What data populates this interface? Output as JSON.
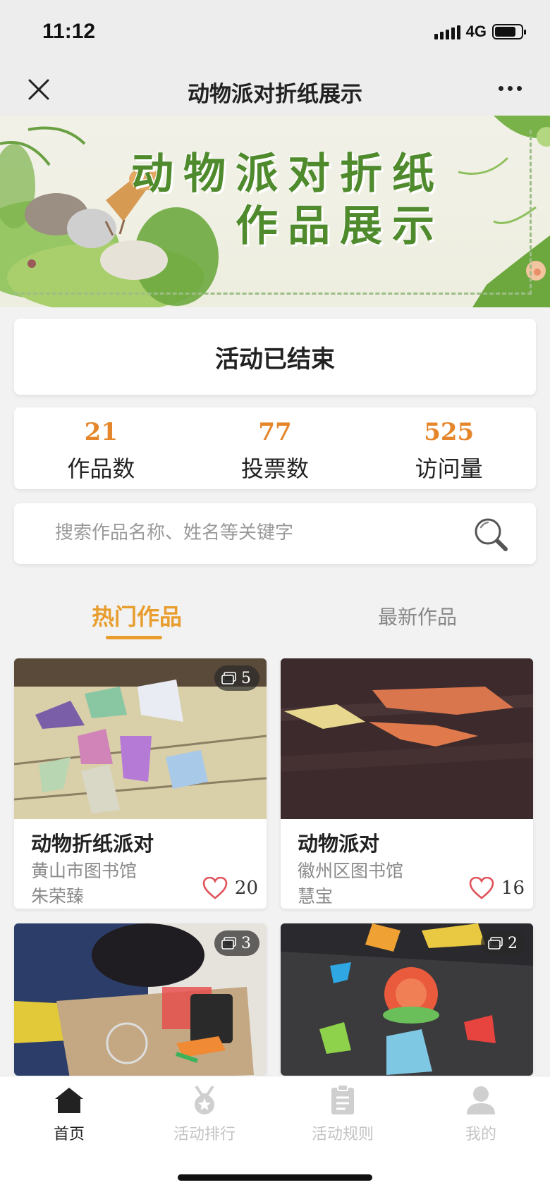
{
  "status_bar": {
    "time": "11:12",
    "network": "4G",
    "battery_level": 0.8
  },
  "nav": {
    "title": "动物派对折纸展示"
  },
  "banner": {
    "title_line1": "动物派对折纸",
    "title_line2": "作品展示"
  },
  "activity_status": "活动已结束",
  "stats": [
    {
      "value": "21",
      "label": "作品数"
    },
    {
      "value": "77",
      "label": "投票数"
    },
    {
      "value": "525",
      "label": "访问量"
    }
  ],
  "search": {
    "placeholder": "搜索作品名称、姓名等关键字"
  },
  "tabs": {
    "hot": "热门作品",
    "latest": "最新作品"
  },
  "works": [
    {
      "title": "动物折纸派对",
      "org": "黄山市图书馆",
      "author": "朱荣臻",
      "likes": "20",
      "images": "5"
    },
    {
      "title": "动物派对",
      "org": "徽州区图书馆",
      "author": "慧宝",
      "likes": "16",
      "images": ""
    },
    {
      "title": "",
      "org": "",
      "author": "",
      "likes": "",
      "images": "3"
    },
    {
      "title": "",
      "org": "",
      "author": "",
      "likes": "",
      "images": "2"
    }
  ],
  "tabbar": [
    {
      "label": "首页",
      "icon": "home-icon",
      "active": true
    },
    {
      "label": "活动排行",
      "icon": "medal-icon",
      "active": false
    },
    {
      "label": "活动规则",
      "icon": "clipboard-icon",
      "active": false
    },
    {
      "label": "我的",
      "icon": "user-icon",
      "active": false
    }
  ],
  "colors": {
    "accent": "#e89d2d",
    "stat_number": "#e5862b",
    "banner_green": "#4f8a2c",
    "heart": "#e0535b"
  }
}
